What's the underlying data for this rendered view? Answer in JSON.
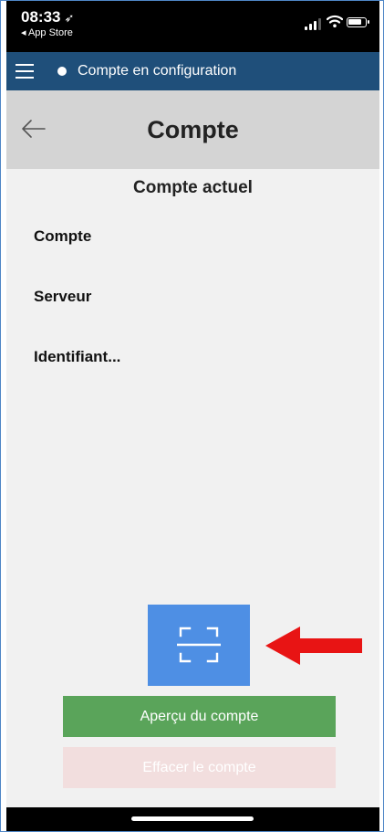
{
  "status_bar": {
    "time": "08:33",
    "location_glyph": "➶",
    "back_app": "◂ App Store"
  },
  "app_bar": {
    "title": "Compte en configuration"
  },
  "header": {
    "title": "Compte"
  },
  "content": {
    "section_title": "Compte actuel",
    "fields": [
      {
        "label": "Compte"
      },
      {
        "label": "Serveur"
      },
      {
        "label": "Identifiant..."
      }
    ]
  },
  "actions": {
    "preview_label": "Aperçu du compte",
    "delete_label": "Effacer le compte"
  },
  "colors": {
    "app_bar": "#1f4f7a",
    "scan_button": "#4e8fe4",
    "preview_button": "#5aa45a",
    "delete_button": "#f2dede",
    "annotation_arrow": "#e81414"
  },
  "icons": {
    "menu": "hamburger-icon",
    "status_dot": "status-dot-icon",
    "back": "back-arrow-icon",
    "scan": "qr-scan-icon",
    "annotation": "red-arrow-icon"
  }
}
